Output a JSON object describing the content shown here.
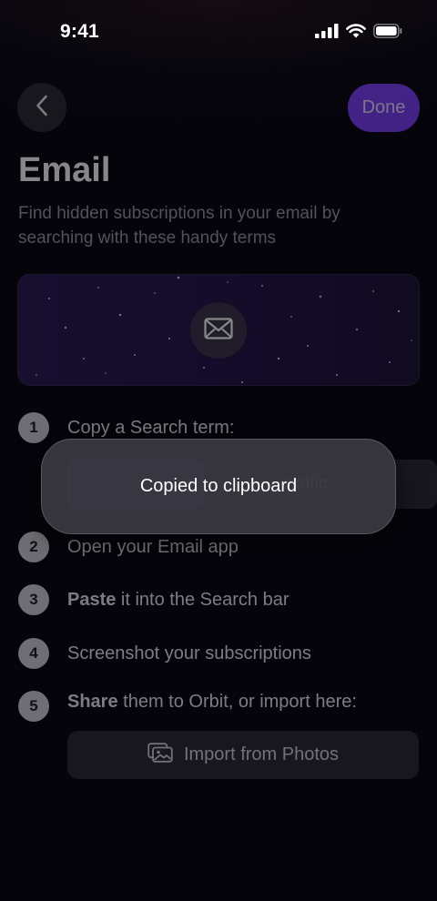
{
  "status_bar": {
    "time": "9:41"
  },
  "nav": {
    "done_label": "Done"
  },
  "header": {
    "title": "Email",
    "subtitle": "Find hidden subscriptions in your email by searching with these handy terms"
  },
  "steps": [
    {
      "number": "1",
      "text": "Copy a Search term:"
    },
    {
      "number": "2",
      "text": "Open your Email app"
    },
    {
      "number": "3",
      "bold": "Paste",
      "text": " it into the Search bar"
    },
    {
      "number": "4",
      "text": "Screenshot your subscriptions"
    },
    {
      "number": "5",
      "bold": "Share",
      "text": " them to Orbit, or import here:"
    }
  ],
  "search_terms": {
    "second_visible": "matic"
  },
  "import": {
    "label": "Import from Photos"
  },
  "toast": {
    "message": "Copied to clipboard"
  },
  "colors": {
    "accent": "#7c3ff5",
    "background": "#05040b",
    "surface": "#2a2931"
  },
  "icons": {
    "back": "chevron-left-icon",
    "mail": "envelope-icon",
    "import": "photos-icon",
    "signal": "cellular-signal-icon",
    "wifi": "wifi-icon",
    "battery": "battery-icon"
  }
}
